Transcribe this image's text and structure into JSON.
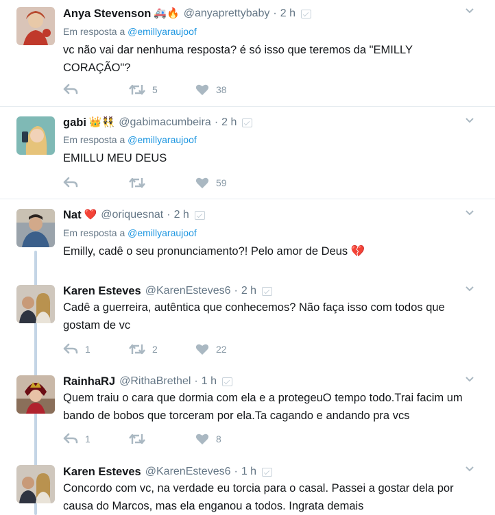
{
  "tweets": [
    {
      "name": "Anya Stevenson",
      "badge": "🚑🔥",
      "handle": "@anyaprettybaby",
      "dot": "·",
      "time": "2 h",
      "reply_prefix": "Em resposta a",
      "reply_handle": "@emillyaraujoof",
      "text": "vc não vai dar nenhuma resposta? é só isso que teremos da \"EMILLY CORAÇÃO\"?",
      "replies": "",
      "retweets": "5",
      "likes": "38"
    },
    {
      "name": "gabi",
      "badge": "👑👯",
      "handle": "@gabimacumbeira",
      "dot": "·",
      "time": "2 h",
      "reply_prefix": "Em resposta a",
      "reply_handle": "@emillyaraujoof",
      "text": "EMILLU MEU DEUS",
      "replies": "",
      "retweets": "",
      "likes": "59"
    },
    {
      "name": "Nat",
      "badge": "❤️",
      "handle": "@oriquesnat",
      "dot": "·",
      "time": "2 h",
      "reply_prefix": "Em resposta a",
      "reply_handle": "@emillyaraujoof",
      "text": "Emilly, cadê o seu pronunciamento?! Pelo amor de Deus 💔",
      "replies": "",
      "retweets": "",
      "likes": ""
    },
    {
      "name": "Karen Esteves",
      "badge": "",
      "handle": "@KarenEsteves6",
      "dot": "·",
      "time": "2 h",
      "text": "Cadê a guerreira, autêntica que conhecemos? Não faça isso com todos que gostam de vc",
      "replies": "1",
      "retweets": "2",
      "likes": "22"
    },
    {
      "name": "RainhaRJ",
      "badge": "",
      "handle": "@RithaBrethel",
      "dot": "·",
      "time": "1 h",
      "text": "Quem traiu o cara que dormia com ela e a protegeuO tempo todo.Trai facim um bando de bobos que torceram por ela.Ta cagando e andando pra vcs",
      "replies": "1",
      "retweets": "",
      "likes": "8"
    },
    {
      "name": "Karen Esteves",
      "badge": "",
      "handle": "@KarenEsteves6",
      "dot": "·",
      "time": "1 h",
      "text": "Concordo com vc, na verdade eu torcia para o casal. Passei a gostar dela por causa do Marcos, mas ela enganou a todos. Ingrata demais",
      "replies": "",
      "retweets": "",
      "likes": ""
    }
  ],
  "colors": {
    "link": "#1b95e0",
    "muted": "#657786",
    "action": "#aab8c2",
    "thread_line": "#c4d5e6",
    "heart": "#e0245e"
  },
  "icons": [
    "reply-icon",
    "retweet-icon",
    "like-icon",
    "chevron-down-icon",
    "verified-badge-icon"
  ]
}
